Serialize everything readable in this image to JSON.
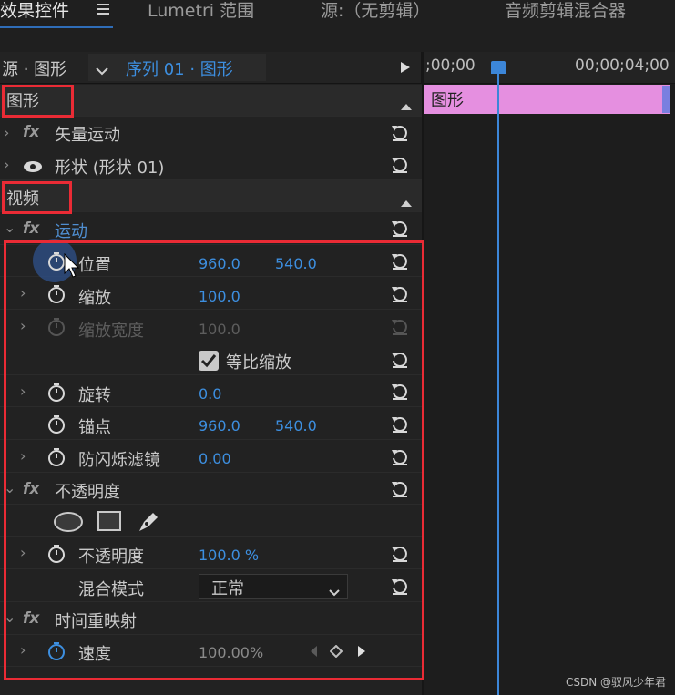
{
  "tabs": [
    {
      "label": "效果控件",
      "active": true
    },
    {
      "label": "Lumetri 范围",
      "active": false
    },
    {
      "label": "源:（无剪辑）",
      "active": false
    },
    {
      "label": "音频剪辑混合器",
      "active": false
    }
  ],
  "tab_menu_icon": "hamburger-icon",
  "header": {
    "source_label": "源 · 图形",
    "sequence_label": "序列 01 · 图形",
    "play_icon": "play-triangle-icon"
  },
  "timeline": {
    "tc_start": ";00;00",
    "tc_end": "00;00;04;00",
    "clip_label": "图形"
  },
  "sections": {
    "graphics": "图形",
    "video": "视频"
  },
  "effects": {
    "vector_motion": "矢量运动",
    "shape": "形状 (形状 01)",
    "motion": "运动",
    "position": {
      "label": "位置",
      "x": "960.0",
      "y": "540.0"
    },
    "scale": {
      "label": "缩放",
      "value": "100.0"
    },
    "scale_width": {
      "label": "缩放宽度",
      "value": "100.0"
    },
    "uniform_scale": {
      "label": "等比缩放",
      "checked": true
    },
    "rotation": {
      "label": "旋转",
      "value": "0.0"
    },
    "anchor": {
      "label": "锚点",
      "x": "960.0",
      "y": "540.0"
    },
    "anti_flicker": {
      "label": "防闪烁滤镜",
      "value": "0.00"
    },
    "opacity_group": "不透明度",
    "opacity": {
      "label": "不透明度",
      "value": "100.0 %"
    },
    "blend_mode": {
      "label": "混合模式",
      "value": "正常"
    },
    "time_remap": "时间重映射",
    "speed": {
      "label": "速度",
      "value": "100.00%"
    }
  },
  "fx_label": "fx",
  "watermark": "CSDN @驭风少年君",
  "colors": {
    "accent": "#3d8fe0",
    "highlight_box": "#ea2b35",
    "clip": "#e58fe0"
  }
}
